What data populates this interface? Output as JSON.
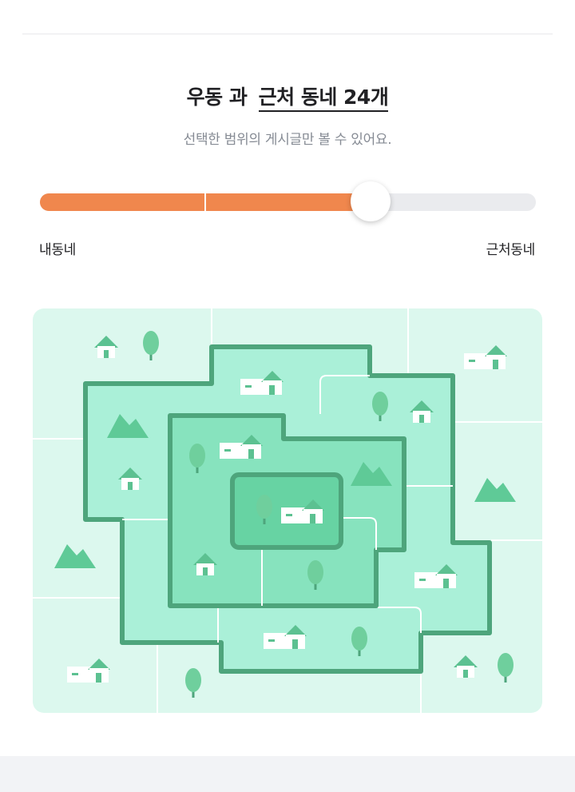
{
  "header": {
    "location": "우동",
    "connector": "과",
    "range_text": "근처 동네 24개"
  },
  "subtitle": "선택한 범위의 게시글만 볼 수 있어요.",
  "slider": {
    "min_label": "내동네",
    "max_label": "근처동네",
    "steps": 4,
    "selected_step": 3,
    "fill_color": "#f0874d",
    "track_color": "#eaebee"
  },
  "map": {
    "icons": [
      "house-icon",
      "tree-icon",
      "mountain-icon",
      "building-icon"
    ],
    "colors": {
      "background": "#dcf8ee",
      "zone_far": "#aaf0d8",
      "zone_near": "#87e3be",
      "zone_home": "#67d3a3",
      "border": "#4ea57c"
    }
  }
}
